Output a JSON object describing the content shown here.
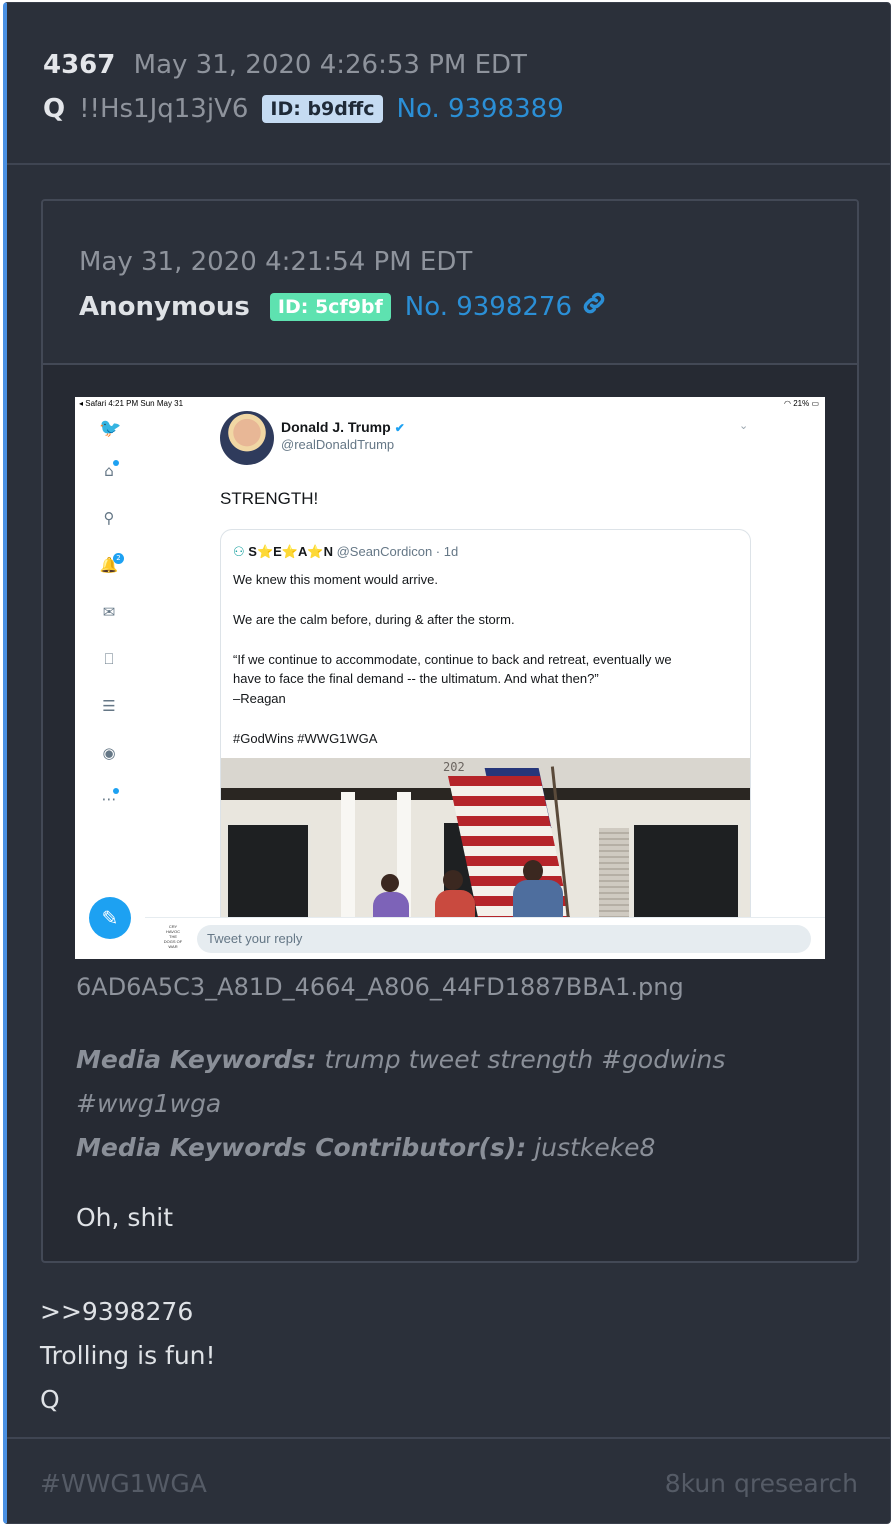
{
  "header": {
    "post_number": "4367",
    "timestamp": "May 31, 2020 4:26:53 PM EDT",
    "name": "Q",
    "tripcode": "!!Hs1Jq13jV6",
    "id_badge": "ID: b9dffc",
    "post_link": "No. 9398389"
  },
  "quoted_post": {
    "timestamp": "May 31, 2020 4:21:54 PM EDT",
    "name": "Anonymous",
    "id_badge": "ID: 5cf9bf",
    "post_link": "No. 9398276",
    "link_icon": "link-icon",
    "screenshot": {
      "status_left": "◂ Safari   4:21 PM   Sun May 31",
      "status_right": "21%",
      "author_name": "Donald J. Trump",
      "author_handle": "@realDonaldTrump",
      "tweet_text": "STRENGTH!",
      "quoted_tweet": {
        "author": "S⭐E⭐A⭐N",
        "handle_time": "@SeanCordicon · 1d",
        "lines": [
          "We knew this moment would arrive.",
          "We are the calm before, during & after the storm.",
          "“If we continue to accommodate, continue to back and retreat, eventually we",
          "have to face the final demand -- the ultimatum. And what then?”",
          "–Reagan",
          "#GodWins #WWG1WGA"
        ],
        "image_house_number": "202"
      },
      "notification_count": "2",
      "reply_placeholder": "Tweet your reply",
      "reply_logo_text": "CRY HAVOC THE DOGS OF WAR"
    },
    "filename": "6AD6A5C3_A81D_4664_A806_44FD1887BBA1.png",
    "media_keywords_label": "Media Keywords:",
    "media_keywords_line1": "trump tweet strength #godwins",
    "media_keywords_line2": "#wwg1wga",
    "contributor_label": "Media Keywords Contributor(s):",
    "contributor": "justkeke8",
    "body": "Oh, shit"
  },
  "post_body": {
    "line1": ">>9398276",
    "line2": "Trolling is fun!",
    "line3": "Q"
  },
  "footer": {
    "tag": "#WWG1WGA",
    "board": "8kun qresearch"
  },
  "colors": {
    "background": "#2b303a",
    "accent_border": "#4a90e2",
    "link": "#2b8fd6",
    "q_id_badge": "#c5dbf2",
    "anon_id_badge": "#5ee2b0"
  }
}
